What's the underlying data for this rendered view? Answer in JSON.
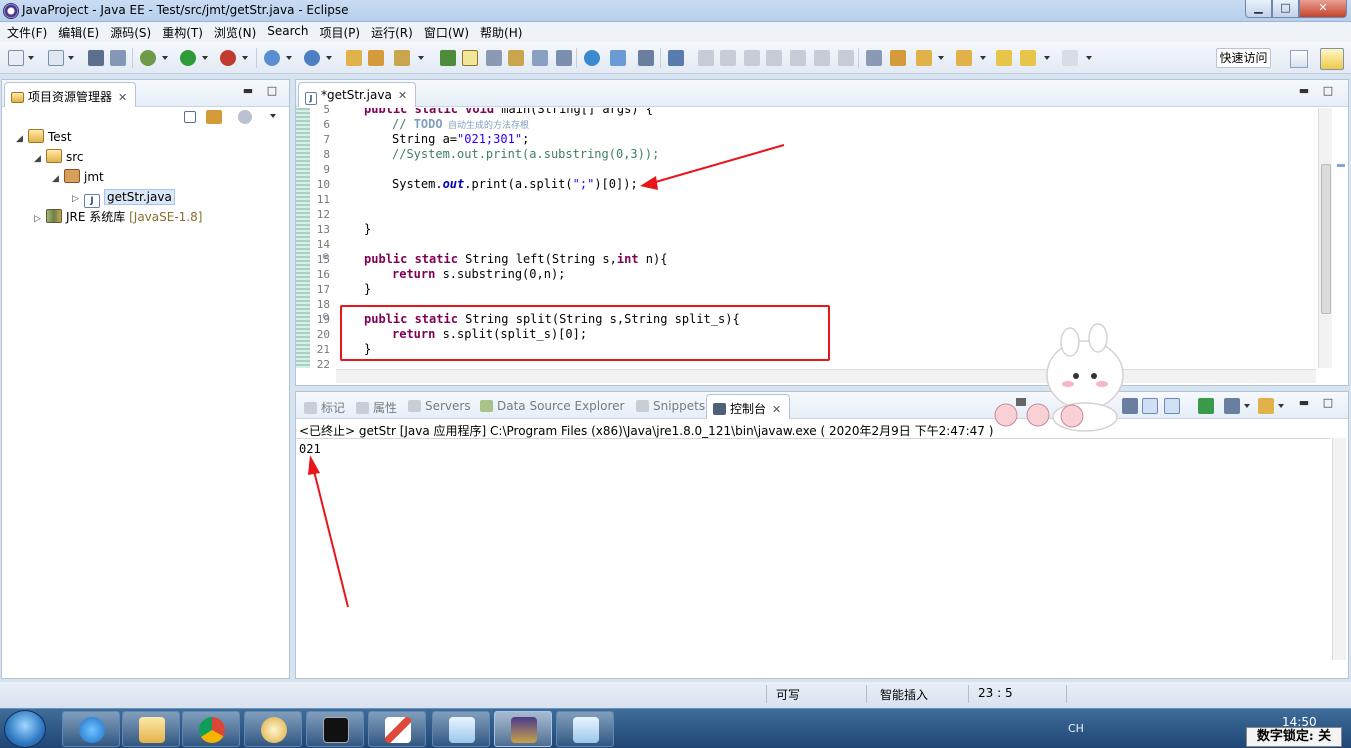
{
  "window": {
    "title": "JavaProject - Java EE - Test/src/jmt/getStr.java - Eclipse",
    "minimize": "▁",
    "maximize": "□",
    "close": "✕"
  },
  "menu": [
    "文件(F)",
    "编辑(E)",
    "源码(S)",
    "重构(T)",
    "浏览(N)",
    "Search",
    "项目(P)",
    "运行(R)",
    "窗口(W)",
    "帮助(H)"
  ],
  "toolbar": {
    "quick_access": "快速访问"
  },
  "explorer": {
    "title": "项目资源管理器",
    "close": "✕",
    "tree": {
      "project": "Test",
      "src": "src",
      "package": "jmt",
      "file": "getStr.java",
      "file_icon": "J",
      "jre_label": "JRE 系统库",
      "jre_version": "[JavaSE-1.8]"
    }
  },
  "editor": {
    "tab_title": "*getStr.java",
    "tab_close": "✕",
    "line_numbers": [
      "5",
      "6",
      "7",
      "8",
      "9",
      "10",
      "11",
      "12",
      "13",
      "14",
      "15",
      "16",
      "17",
      "18",
      "19",
      "20",
      "21",
      "22"
    ],
    "code": {
      "l5_kw": "public static void",
      "l5_rest": " main(String[] args) {",
      "l6_comment": "// ",
      "l6_todo": "TODO",
      "l6_cn": " 自动生成的方法存根",
      "l7_a": "String a=",
      "l7_str": "\"021;301\"",
      "l7_end": ";",
      "l8_comment": "//System.out.print(a.substring(0,3));",
      "l10_a": "System.",
      "l10_out": "out",
      "l10_b": ".print(a.split(",
      "l10_str": "\";\"",
      "l10_c": ")[0]);",
      "l12": "}",
      "l14_kw": "public static",
      "l14_rest": " String left(String s,",
      "l14_int": "int",
      "l14_end": " n){",
      "l15_kw": "return",
      "l15_rest": " s.substring(0,n);",
      "l16": "}",
      "l18_kw": "public static",
      "l18_rest": " String split(String s,String split_s){",
      "l19_kw": "return",
      "l19_rest": " s.split(split_s)[0];",
      "l20": "}"
    }
  },
  "console": {
    "tabs": [
      "标记",
      "属性",
      "Servers",
      "Data Source Explorer",
      "Snippets",
      "控制台"
    ],
    "active_tab": "控制台",
    "tab_close": "✕",
    "description": "<已终止> getStr [Java 应用程序] C:\\Program Files (x86)\\Java\\jre1.8.0_121\\bin\\javaw.exe ( 2020年2月9日 下午2:47:47 )",
    "output": "021"
  },
  "statusbar": {
    "writable": "可写",
    "insert_mode": "智能插入",
    "position": "23 : 5"
  },
  "taskbar": {
    "lang": "CH",
    "clock": "14:50",
    "numlock": "数字锁定: 关"
  },
  "colors": {
    "keyword": "#7f0055",
    "comment": "#3f7f5f",
    "string": "#2a00ff",
    "highlight_box": "#e8161a"
  }
}
